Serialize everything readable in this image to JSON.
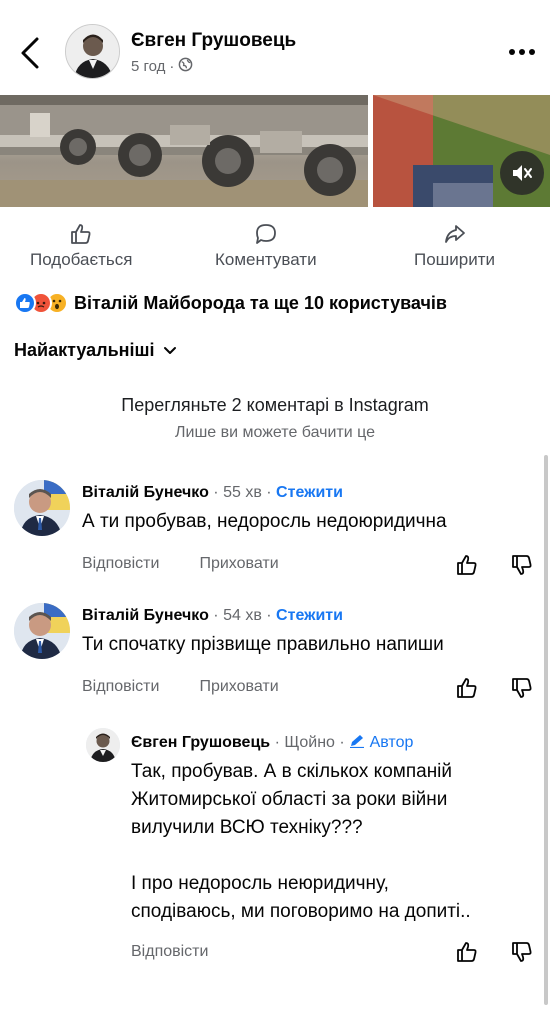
{
  "header": {
    "author": "Євген Грушовець",
    "time": "5 год",
    "separator": "·"
  },
  "actions": {
    "like": "Подобається",
    "comment": "Коментувати",
    "share": "Поширити"
  },
  "reactions": {
    "text": "Віталій Майборода та ще 10 користувачів",
    "types": [
      "like",
      "angry",
      "wow"
    ]
  },
  "sort": {
    "label": "Найактуальніші"
  },
  "instagram": {
    "link": "Перегляньте 2 коментарі в Instagram",
    "note": "Лише ви можете бачити це"
  },
  "comments": [
    {
      "author": "Віталій Бунечко",
      "time": "· 55 хв ·",
      "follow": "Стежити",
      "text": "А ти пробував, недоросль недоюридична",
      "reply": "Відповісти",
      "hide": "Приховати"
    },
    {
      "author": "Віталій Бунечко",
      "time": "· 54 хв ·",
      "follow": "Стежити",
      "text": "Ти спочатку прізвище правильно напиши",
      "reply": "Відповісти",
      "hide": "Приховати"
    }
  ],
  "reply": {
    "author": "Євген Грушовець",
    "time": "· Щойно ·",
    "badge": "Автор",
    "lines": [
      "Так, пробував. А в скількох компаній",
      "Житомирської області за роки війни",
      "вилучили ВСЮ техніку???",
      "",
      "І про недоросль неюридичну,",
      "сподіваюсь, ми поговоримо на допиті.."
    ],
    "reply_label": "Відповісти"
  },
  "colors": {
    "link_blue": "#1877f2",
    "secondary_text": "#65676b",
    "like_blue": "#1877f2",
    "angry_orange": "#f0533a",
    "wow_yellow": "#f7b125"
  }
}
